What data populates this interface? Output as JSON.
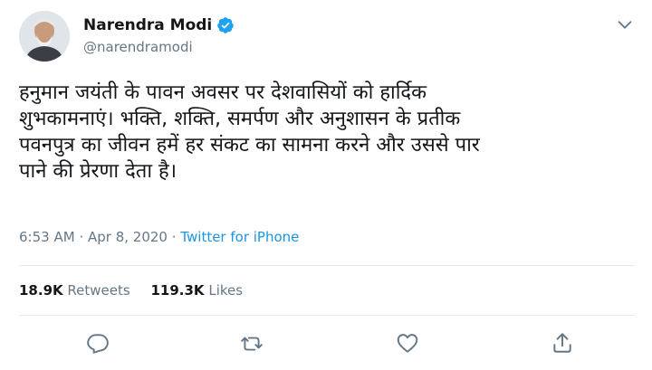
{
  "author": {
    "name": "Narendra Modi",
    "handle": "@narendramodi",
    "verified": true
  },
  "tweet": {
    "text": "हनुमान जयंती के पावन अवसर पर देशवासियों को हार्दिक\nशुभकामनाएं। भक्ति, शक्ति, समर्पण और अनुशासन के प्रतीक\nपवनपुत्र का जीवन हमें हर संकट का सामना करने और उससे पार\nपाने की प्रेरणा देता है।",
    "time": "6:53 AM",
    "date": "Apr 8, 2020",
    "separator": "·",
    "source": "Twitter for iPhone"
  },
  "stats": {
    "retweets_count": "18.9K",
    "retweets_label": "Retweets",
    "likes_count": "119.3K",
    "likes_label": "Likes"
  },
  "colors": {
    "accent": "#1da1f2",
    "link": "#1b95e0",
    "muted": "#657786",
    "text": "#14171a",
    "divider": "#e6ecf0"
  },
  "icons": {
    "verified": "verified-badge-icon",
    "caret": "chevron-down-icon",
    "reply": "reply-icon",
    "retweet": "retweet-icon",
    "like": "heart-icon",
    "share": "share-icon"
  }
}
